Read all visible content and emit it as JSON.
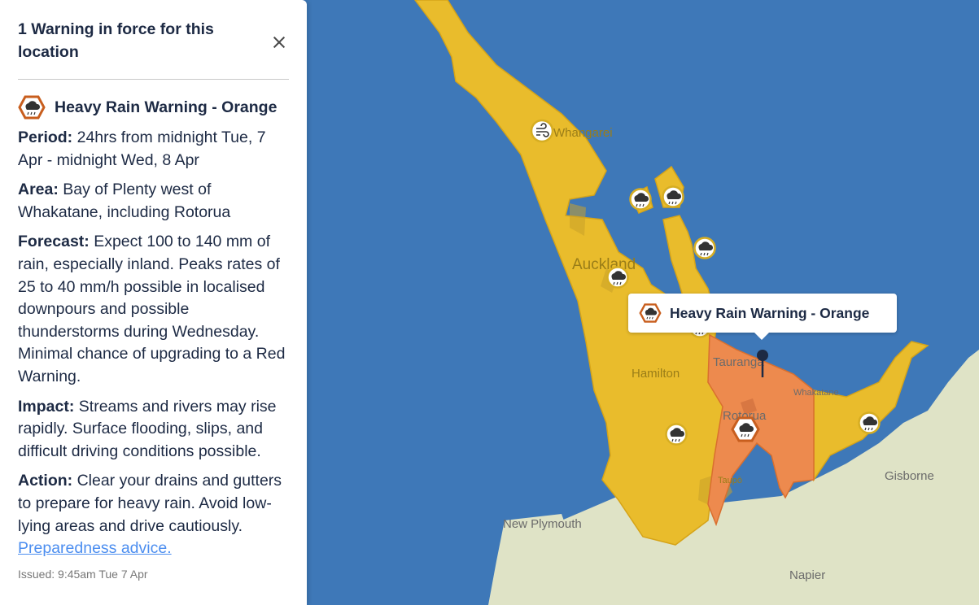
{
  "panel": {
    "title": "1 Warning in force for this location",
    "warning": {
      "title": "Heavy Rain Warning - Orange",
      "period_label": "Period:",
      "period": " 24hrs from midnight Tue, 7 Apr - midnight Wed, 8 Apr",
      "area_label": "Area:",
      "area": " Bay of Plenty west of Whakatane, including Rotorua",
      "forecast_label": "Forecast:",
      "forecast": " Expect 100 to 140 mm of rain, especially inland. Peaks rates of 25 to 40 mm/h possible in localised downpours and possible thunderstorms during Wednesday. Minimal chance of upgrading to a Red Warning.",
      "impact_label": "Impact:",
      "impact": " Streams and rivers may rise rapidly. Surface flooding, slips, and difficult driving conditions possible.",
      "action_label": "Action:",
      "action": " Clear your drains and gutters to prepare for heavy rain. Avoid low-lying areas and drive cautiously. ",
      "action_link": "Preparedness advice.",
      "issued": "Issued: 9:45am Tue 7 Apr"
    }
  },
  "tooltip": {
    "label": "Heavy Rain Warning - Orange"
  },
  "map": {
    "places": {
      "whangarei": "Whangarei",
      "auckland": "Auckland",
      "hamilton": "Hamilton",
      "tauranga": "Tauranga",
      "rotorua": "Rotorua",
      "taupo": "Taupō",
      "whakatane": "Whakatane",
      "gisborne": "Gisborne",
      "new_plymouth": "New Plymouth",
      "napier": "Napier"
    },
    "icons": {
      "rain": "heavy-rain-icon",
      "wind": "wind-icon",
      "close": "close-icon"
    }
  },
  "colors": {
    "ocean": "#3e78b8",
    "land": "#dfe3c6",
    "warning_yellow": "#e9bc2c",
    "warning_orange": "#ed8a4e",
    "text": "#1d2a44",
    "link": "#4c8ef0"
  }
}
